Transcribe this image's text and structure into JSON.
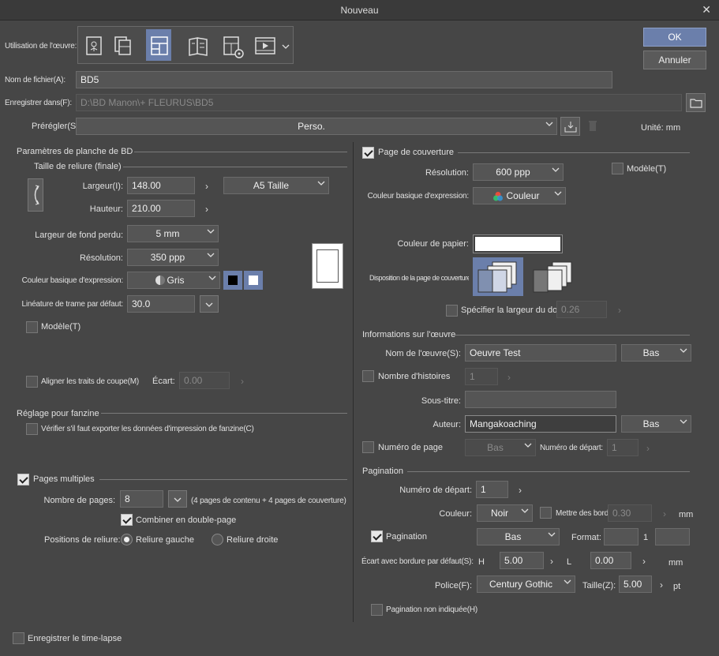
{
  "window": {
    "title": "Nouveau"
  },
  "actions": {
    "ok": "OK",
    "cancel": "Annuler"
  },
  "usage": {
    "label": "Utilisation de l'œuvre:"
  },
  "filename": {
    "label": "Nom de fichier(A):",
    "value": "BD5"
  },
  "save_in": {
    "label": "Enregistrer dans(F):",
    "value": "D:\\BD Manon\\+ FLEURUS\\BD5"
  },
  "preset": {
    "label": "Prérégler(S):",
    "value": "Perso.",
    "unit": "Unité:  mm"
  },
  "left": {
    "section_title": "Paramètres de planche de BD",
    "binding_size_title": "Taille de reliure (finale)",
    "width_label": "Largeur(I):",
    "width_value": "148.00",
    "size_preset": "A5 Taille",
    "height_label": "Hauteur:",
    "height_value": "210.00",
    "bleed_label": "Largeur de fond perdu:",
    "bleed_value": "5 mm",
    "resolution_label": "Résolution:",
    "resolution_value": "350 ppp",
    "color_label": "Couleur basique d'expression:",
    "color_value": "Gris",
    "lpi_label": "Linéature de trame par défaut:",
    "lpi_value": "30.0",
    "template_label": "Modèle(T)",
    "crop_marks_label": "Aligner les traits de coupe(M)",
    "gap_label": "Écart:",
    "gap_value": "0.00",
    "fanzine_title": "Réglage pour fanzine",
    "fanzine_check": "Vérifier s'il faut exporter les données d'impression de fanzine(C)",
    "multipage_label": "Pages multiples",
    "page_count_label": "Nombre de pages:",
    "page_count_value": "8",
    "page_count_note": "(4 pages de contenu + 4 pages de couverture)",
    "combine_label": "Combiner en double-page",
    "binding_label": "Positions de reliure:",
    "binding_left": "Reliure gauche",
    "binding_right": "Reliure droite"
  },
  "right": {
    "cover_label": "Page de couverture",
    "cover_resolution_label": "Résolution:",
    "cover_resolution_value": "600 ppp",
    "cover_template_label": "Modèle(T)",
    "cover_color_label": "Couleur basique d'expression:",
    "cover_color_value": "Couleur",
    "paper_color_label": "Couleur de papier:",
    "paper_color": "#ffffff",
    "cover_layout_label": "Disposition de la page de couverture",
    "spine_label": "Spécifier la largeur du dos",
    "spine_value": "0.26",
    "work_info_title": "Informations sur l'œuvre",
    "work_name_label": "Nom de l'œuvre(S):",
    "work_name_value": "Oeuvre Test",
    "work_name_pos": "Bas",
    "stories_label": "Nombre d'histoires",
    "stories_value": "1",
    "subtitle_label": "Sous-titre:",
    "subtitle_value": "",
    "author_label": "Auteur:",
    "author_value": "Mangakoaching",
    "author_pos": "Bas",
    "page_number_label": "Numéro de page",
    "page_number_pos": "Bas",
    "start_number_label_small": "Numéro de départ:",
    "start_number_small_value": "1",
    "pagination_title": "Pagination",
    "start_number_label": "Numéro de départ:",
    "start_number_value": "1",
    "color_label": "Couleur:",
    "color_value": "Noir",
    "edge_label": "Mettre des bords",
    "edge_value": "0.30",
    "edge_unit": "mm",
    "pagination_label": "Pagination",
    "pagination_pos": "Bas",
    "format_label": "Format:",
    "format_mid": "1",
    "margin_label": "Écart avec bordure par défaut(S):",
    "h_label": "H",
    "h_value": "5.00",
    "l_label": "L",
    "l_value": "0.00",
    "margin_unit": "mm",
    "font_label": "Police(F):",
    "font_value": "Century Gothic",
    "size_label": "Taille(Z):",
    "size_value": "5.00",
    "size_unit": "pt",
    "hidden_pagination_label": "Pagination non indiquée(H)"
  },
  "timelapse": {
    "label": "Enregistrer le time-lapse"
  },
  "colors": {
    "accent": "#6b7fab",
    "background": "#464646"
  }
}
